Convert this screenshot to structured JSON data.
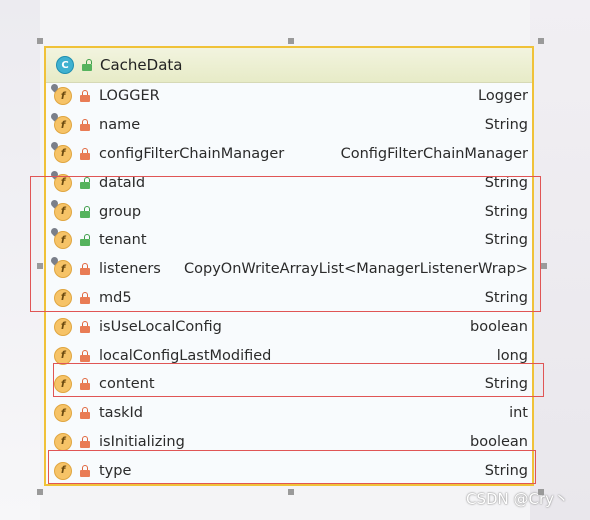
{
  "class": {
    "name": "CacheData",
    "icon": "class-icon",
    "access_icon": "open-lock-icon"
  },
  "fields": [
    {
      "name": "LOGGER",
      "type": "Logger",
      "access": "private",
      "pinned": true
    },
    {
      "name": "name",
      "type": "String",
      "access": "private",
      "pinned": true
    },
    {
      "name": "configFilterChainManager",
      "type": "ConfigFilterChainManager",
      "access": "private",
      "pinned": true
    },
    {
      "name": "dataId",
      "type": "String",
      "access": "public",
      "pinned": true
    },
    {
      "name": "group",
      "type": "String",
      "access": "public",
      "pinned": true
    },
    {
      "name": "tenant",
      "type": "String",
      "access": "public",
      "pinned": true
    },
    {
      "name": "listeners",
      "type": "CopyOnWriteArrayList<ManagerListenerWrap>",
      "access": "private",
      "pinned": true
    },
    {
      "name": "md5",
      "type": "String",
      "access": "private",
      "pinned": false
    },
    {
      "name": "isUseLocalConfig",
      "type": "boolean",
      "access": "private",
      "pinned": false
    },
    {
      "name": "localConfigLastModified",
      "type": "long",
      "access": "private",
      "pinned": false
    },
    {
      "name": "content",
      "type": "String",
      "access": "private",
      "pinned": false
    },
    {
      "name": "taskId",
      "type": "int",
      "access": "private",
      "pinned": false
    },
    {
      "name": "isInitializing",
      "type": "boolean",
      "access": "private",
      "pinned": false
    },
    {
      "name": "type",
      "type": "String",
      "access": "private",
      "pinned": false
    }
  ],
  "colors": {
    "selection_border": "#f0c239",
    "highlight_box": "#e05555",
    "field_icon": "#f6c367",
    "private_lock": "#e97c55",
    "public_lock": "#55b35d"
  },
  "watermark": "CSDN @Cry丶"
}
